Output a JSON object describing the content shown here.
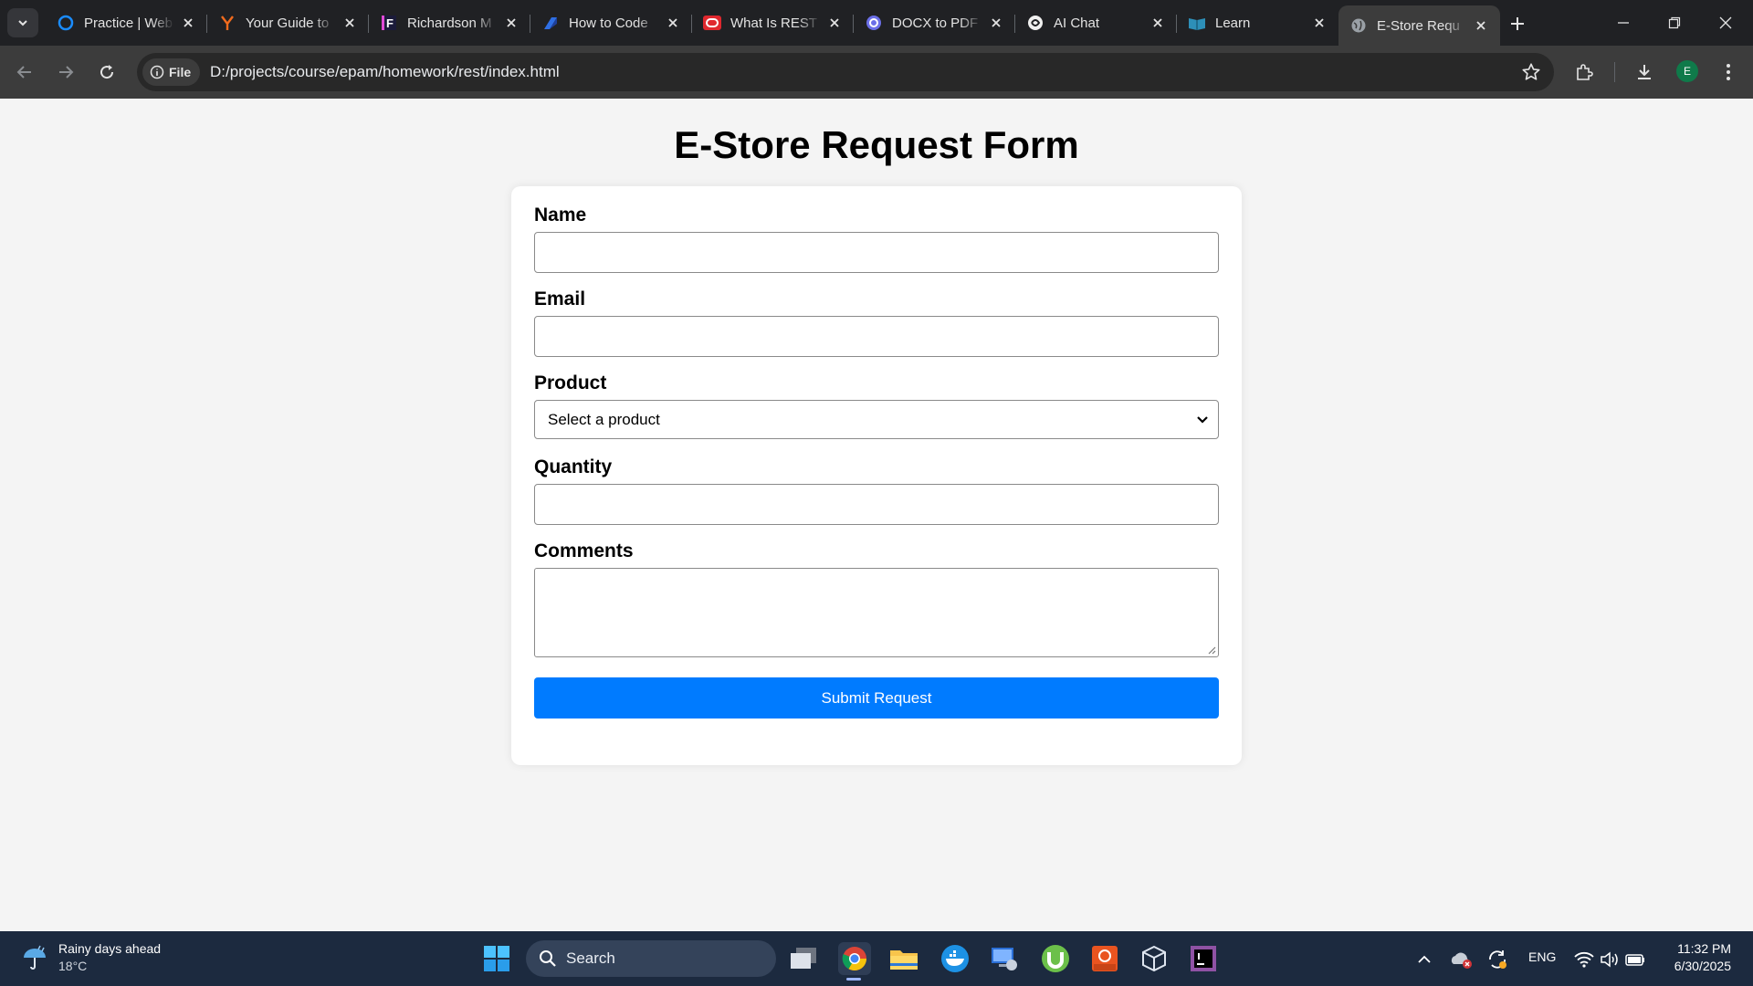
{
  "browser": {
    "tabs": [
      {
        "title": "Practice | Web",
        "icon": "practice-ring-icon",
        "active": false
      },
      {
        "title": "Your Guide to",
        "icon": "y-logo-icon",
        "active": false
      },
      {
        "title": "Richardson M",
        "icon": "f-logo-icon",
        "active": false
      },
      {
        "title": "How to Code",
        "icon": "blue-arrow-icon",
        "active": false
      },
      {
        "title": "What Is REST",
        "icon": "red-oracle-icon",
        "active": false
      },
      {
        "title": "DOCX to PDF",
        "icon": "purple-circle-icon",
        "active": false
      },
      {
        "title": "AI Chat",
        "icon": "ai-swirl-icon",
        "active": false
      },
      {
        "title": "Learn",
        "icon": "learn-book-icon",
        "active": false
      },
      {
        "title": "E-Store Requ",
        "icon": "globe-icon",
        "active": true
      }
    ],
    "address": {
      "scheme_chip": "File",
      "url": "D:/projects/course/epam/homework/rest/index.html"
    },
    "profile_initial": "E",
    "colors": {
      "tabstrip": "#202124",
      "toolbar": "#3c3c3c"
    }
  },
  "page": {
    "title": "E-Store Request Form",
    "fields": {
      "name_label": "Name",
      "email_label": "Email",
      "product_label": "Product",
      "product_selected": "Select a product",
      "quantity_label": "Quantity",
      "comments_label": "Comments"
    },
    "submit_label": "Submit Request",
    "colors": {
      "accent": "#007bff",
      "background": "#f4f4f4",
      "card": "#ffffff"
    }
  },
  "taskbar": {
    "weather": {
      "summary": "Rainy days ahead",
      "temperature": "18°C"
    },
    "search_placeholder": "Search",
    "pinned": [
      "task-view-icon",
      "chrome-icon",
      "file-explorer-icon",
      "docker-icon",
      "remote-desktop-icon",
      "utorrent-icon",
      "ubuntu-icon",
      "virtualbox-icon",
      "intellij-icon"
    ],
    "tray": {
      "language": "ENG"
    },
    "clock": {
      "time": "11:32 PM",
      "date": "6/30/2025"
    }
  }
}
